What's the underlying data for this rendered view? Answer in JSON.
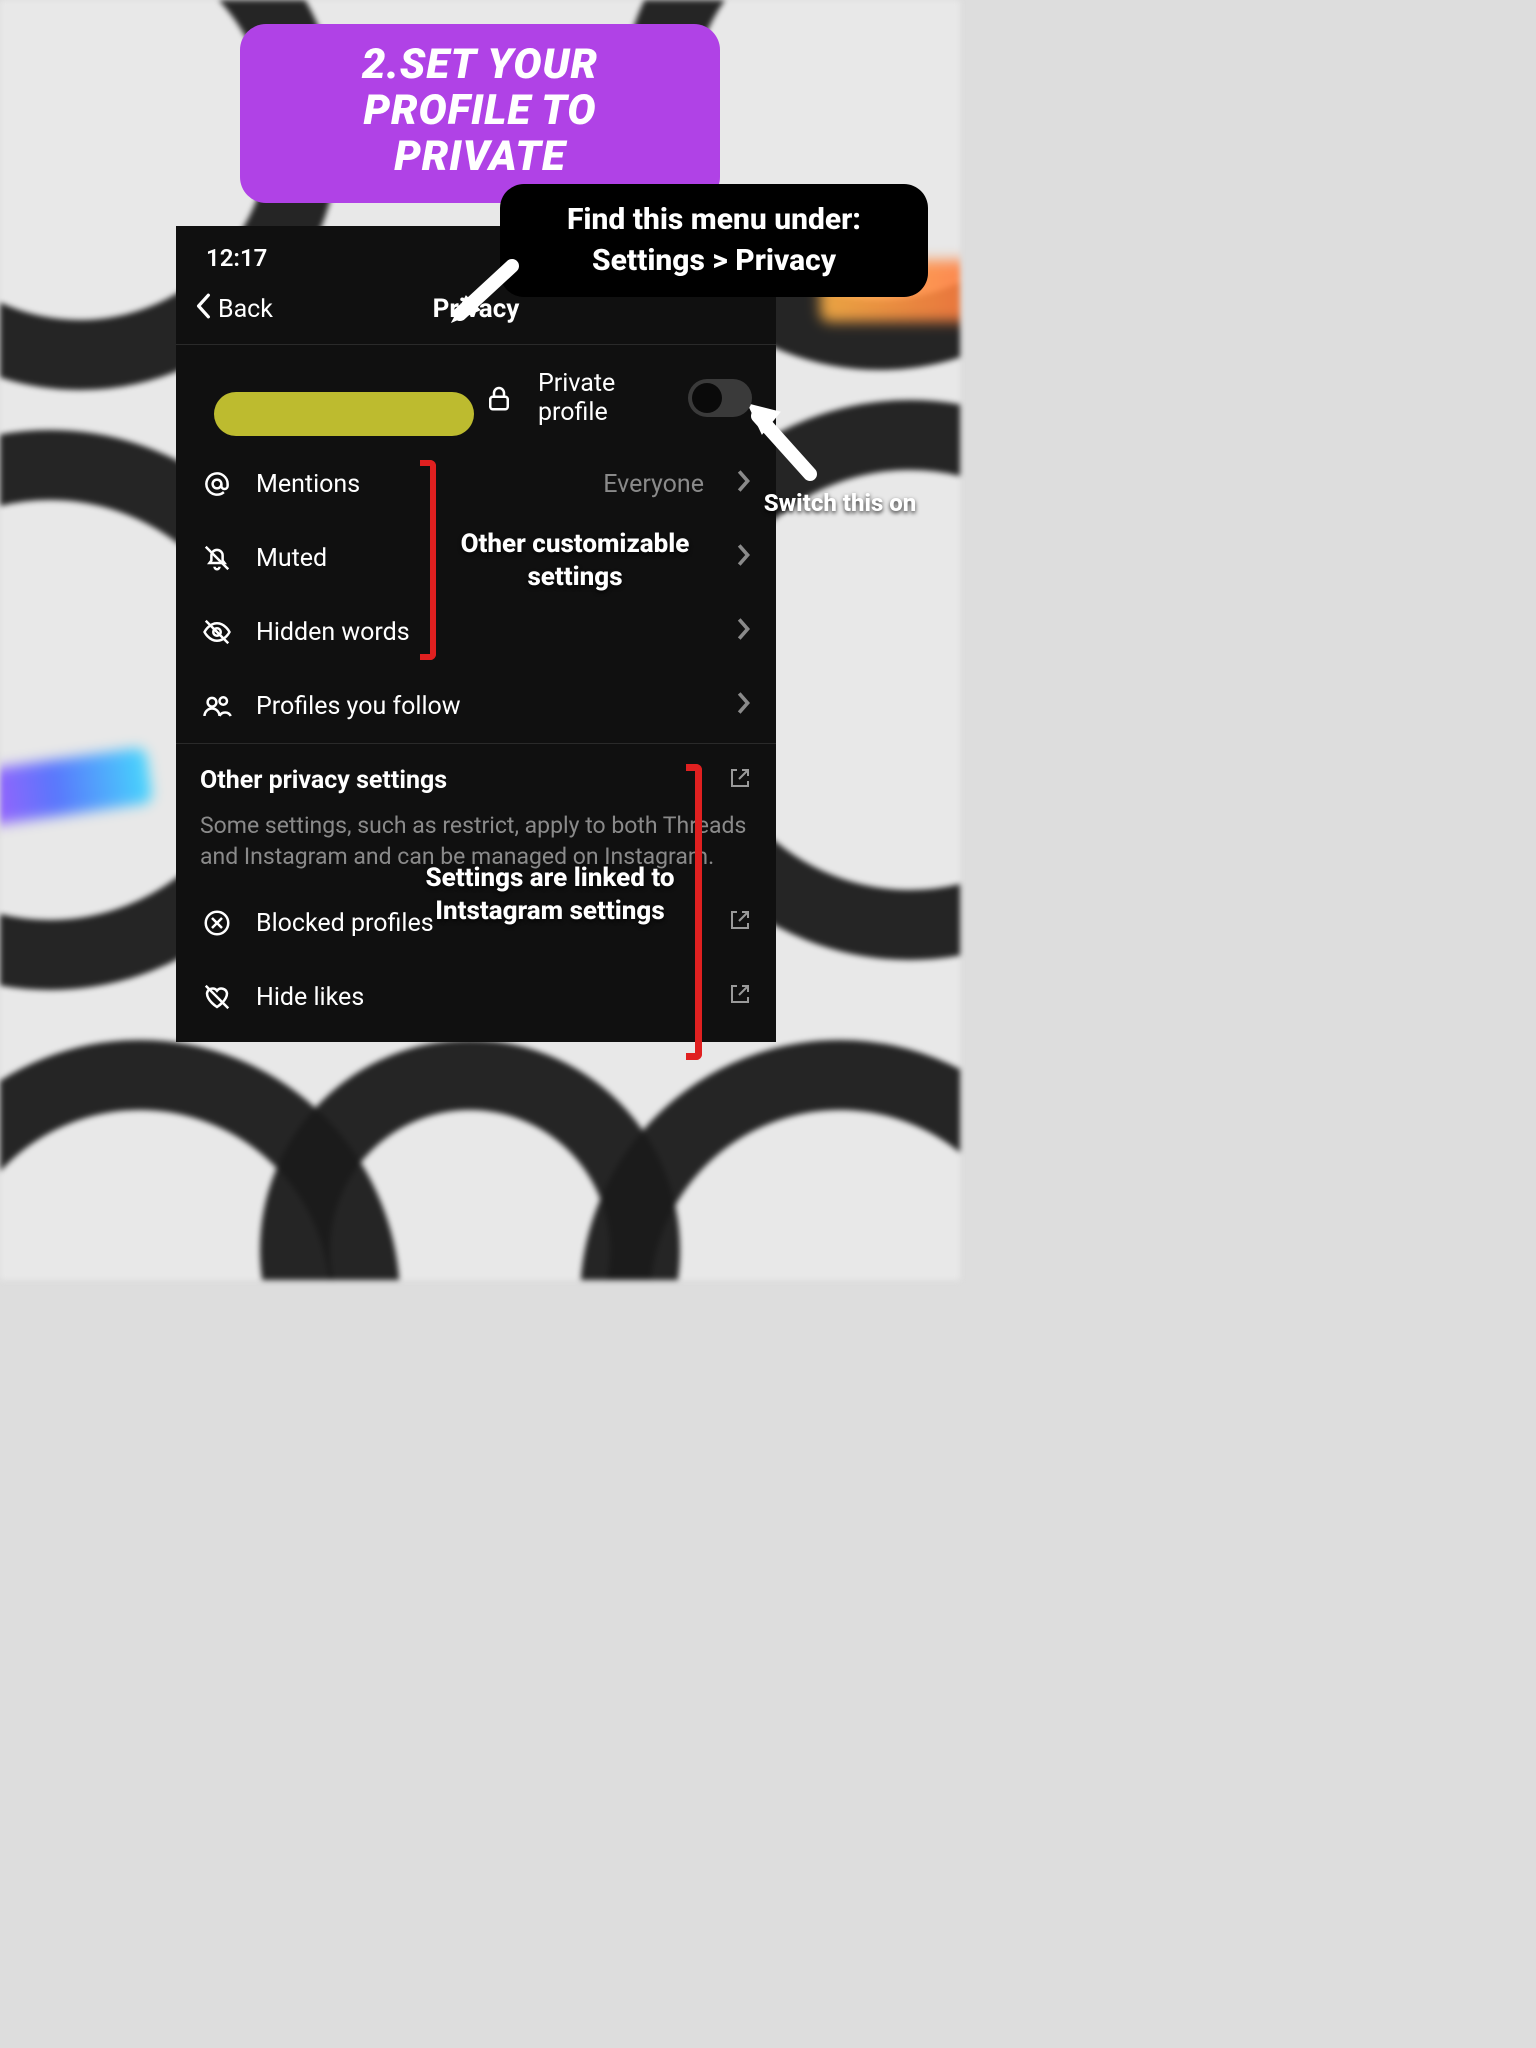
{
  "banner": "2.SET YOUR PROFILE TO\nPRIVATE",
  "status_time": "12:17",
  "nav_back": "Back",
  "nav_title": "Privacy",
  "rows": {
    "private_profile": "Private profile",
    "mentions": "Mentions",
    "mentions_value": "Everyone",
    "muted": "Muted",
    "hidden_words": "Hidden words",
    "profiles_follow": "Profiles you follow"
  },
  "section2": {
    "heading": "Other privacy settings",
    "desc": "Some settings, such as restrict, apply to both Threads and Instagram and can be managed on Instagram.",
    "blocked": "Blocked profiles",
    "hide_likes": "Hide likes"
  },
  "annotations": {
    "find_menu_line1": "Find this menu under:",
    "find_menu_line2": "Settings > Privacy",
    "switch_on": "Switch this on",
    "other_settings": "Other customizable settings",
    "linked_ig": "Settings are linked to Intstagram settings"
  }
}
